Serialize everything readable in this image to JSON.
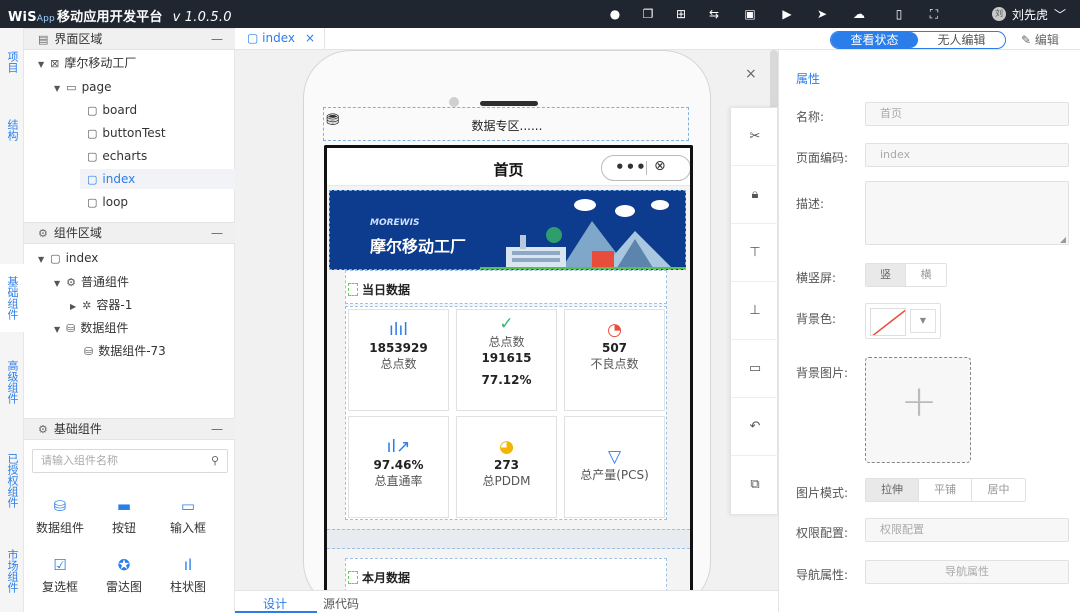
{
  "app": {
    "brand": "WiS",
    "brand_sub": "App",
    "title": "移动应用开发平台",
    "version": "v 1.0.5.0"
  },
  "topbar": {
    "icons": [
      "record-icon",
      "copy-icon",
      "add-page-icon",
      "swap-icon",
      "bag-icon",
      "play-icon",
      "send-icon",
      "cloud-upload-icon",
      "book-icon",
      "fullscreen-icon"
    ],
    "user_avatar": "刘",
    "user_name": "刘先虎",
    "user_arrow": "﹀"
  },
  "left_strip": {
    "tabs": [
      "项目",
      "结构",
      "基础组件",
      "高级组件",
      "已授权组件",
      "市场组件"
    ]
  },
  "interface_area": {
    "title": "界面区域",
    "tree": {
      "root": "摩尔移动工厂",
      "folder": "page",
      "pages": [
        "board",
        "buttonTest",
        "echarts",
        "index",
        "loop"
      ],
      "selected": "index"
    }
  },
  "component_area": {
    "title": "组件区域",
    "tree": {
      "root": "index",
      "common_group": "普通组件",
      "container": "容器-1",
      "data_group": "数据组件",
      "data_item": "数据组件-73"
    }
  },
  "basic_components": {
    "title": "基础组件",
    "search_placeholder": "请输入组件名称",
    "items": [
      {
        "label": "数据组件",
        "icon": "database-icon"
      },
      {
        "label": "按钮",
        "icon": "button-icon"
      },
      {
        "label": "输入框",
        "icon": "input-icon"
      },
      {
        "label": "复选框",
        "icon": "checkbox-icon"
      },
      {
        "label": "雷达图",
        "icon": "radar-icon"
      },
      {
        "label": "柱状图",
        "icon": "bar-chart-icon"
      }
    ]
  },
  "editor_tabs": {
    "active_tab": "index",
    "close": "×",
    "view_state": "查看状态",
    "unmanned_edit": "无人编辑",
    "edit": "编辑"
  },
  "canvas": {
    "data_zone_title": "数据专区......",
    "page_title": "首页",
    "capsule_dots": "•••",
    "capsule_close": "⊗",
    "banner_small": "MOREWIS",
    "banner_big": "摩尔移动工厂",
    "daily_section": "当日数据",
    "monthly_section": "本月数据",
    "cells": [
      {
        "icon": "bar-chart-icon",
        "glyph": "ılıl",
        "color": "#2b7de9",
        "value": "1853929",
        "label": "总点数",
        "extra": ""
      },
      {
        "icon": "check-circle-icon",
        "glyph": "✓",
        "color": "#3cb371",
        "value": "191615",
        "label": "总点数",
        "extra": "77.12%"
      },
      {
        "icon": "pie-icon",
        "glyph": "◔",
        "color": "#e84c3d",
        "value": "507",
        "label": "不良点数",
        "extra": ""
      },
      {
        "icon": "trend-icon",
        "glyph": "ıl↗",
        "color": "#2b7de9",
        "value": "97.46%",
        "label": "总直通率",
        "extra": ""
      },
      {
        "icon": "donut-icon",
        "glyph": "◕",
        "color": "#f5b400",
        "value": "273",
        "label": "总PDDM",
        "extra": ""
      },
      {
        "icon": "triangle-icon",
        "glyph": "▽",
        "color": "#2b7de9",
        "value": "",
        "label": "总产量(PCS)",
        "extra": ""
      }
    ]
  },
  "toolbox": {
    "close": "×",
    "buttons": [
      "cut-icon",
      "lock-icon",
      "align-top-icon",
      "align-bottom-icon",
      "save-icon",
      "undo-icon",
      "delete-icon"
    ]
  },
  "bottom_tabs": {
    "design": "设计",
    "source": "源代码"
  },
  "properties": {
    "header": "属性",
    "name_label": "名称:",
    "name_value": "首页",
    "code_label": "页面编码:",
    "code_value": "index",
    "desc_label": "描述:",
    "orientation_label": "横竖屏:",
    "orientation_options": [
      "竖",
      "横"
    ],
    "bgcolor_label": "背景色:",
    "bgimage_label": "背景图片:",
    "imgmode_label": "图片模式:",
    "imgmode_options": [
      "拉伸",
      "平铺",
      "居中"
    ],
    "permission_label": "权限配置:",
    "permission_value": "权限配置",
    "nav_label": "导航属性:",
    "nav_value": "导航属性"
  },
  "colors": {
    "accent": "#2b7de9",
    "topbar": "#1f2630",
    "banner": "#0d3b8e"
  }
}
